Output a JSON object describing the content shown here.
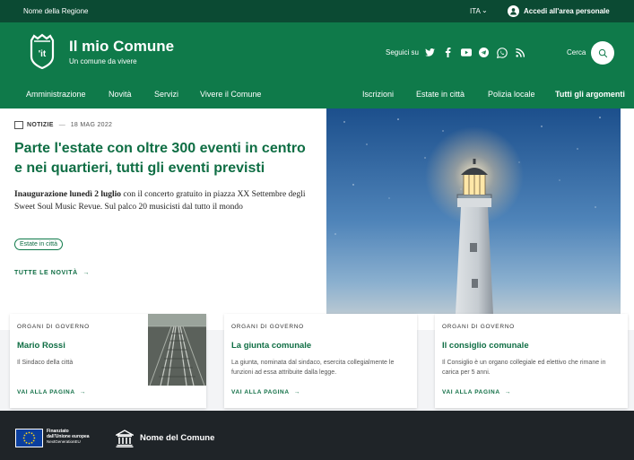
{
  "topbar": {
    "region": "Nome della Regione",
    "language": "ITA",
    "login": "Accedi all'area personale"
  },
  "header": {
    "title": "Il mio Comune",
    "subtitle": "Un comune da vivere",
    "logo_text": "'it",
    "social_label": "Seguici su",
    "social_icons": [
      "twitter-icon",
      "facebook-icon",
      "youtube-icon",
      "telegram-icon",
      "whatsapp-icon",
      "rss-icon"
    ],
    "search_label": "Cerca"
  },
  "nav": {
    "left": [
      "Amministrazione",
      "Novità",
      "Servizi",
      "Vivere il Comune"
    ],
    "right": [
      "Iscrizioni",
      "Estate in città",
      "Polizia locale"
    ],
    "all_topics": "Tutti gli argomenti"
  },
  "hero": {
    "category": "NOTIZIE",
    "date": "18 MAG 2022",
    "title": "Parte l'estate con oltre 300 eventi in centro e nei quartieri, tutti gli eventi previsti",
    "excerpt_bold": "Inaugurazione lunedì 2 luglio",
    "excerpt_rest": " con il concerto gratuito in piazza XX Settembre degli Sweet Soul Music Revue. Sul palco 20 musicisti dal tutto il mondo",
    "chip": "Estate in città",
    "all_news": "TUTTE LE NOVITÀ"
  },
  "cards": [
    {
      "tag": "ORGANI DI GOVERNO",
      "title": "Mario Rossi",
      "desc": "Il Sindaco della città",
      "link": "VAI ALLA PAGINA"
    },
    {
      "tag": "ORGANI DI GOVERNO",
      "title": "La giunta comunale",
      "desc": "La giunta, nominata dal sindaco, esercita collegialmente le funzioni ad essa attribuite dalla legge.",
      "link": "VAI ALLA PAGINA"
    },
    {
      "tag": "ORGANI DI GOVERNO",
      "title": "Il consiglio comunale",
      "desc": "Il Consiglio è un organo collegiale ed elettivo che rimane in carica per 5 anni.",
      "link": "VAI ALLA PAGINA"
    }
  ],
  "footer": {
    "eu_line1": "Finanziato",
    "eu_line2": "dall'Unione europea",
    "eu_line3": "NextGenerationEU",
    "name": "Nome del Comune"
  },
  "colors": {
    "topbar": "#0b4a33",
    "header": "#0f7a4a",
    "accent": "#0f6e44",
    "footer": "#1f2428"
  }
}
